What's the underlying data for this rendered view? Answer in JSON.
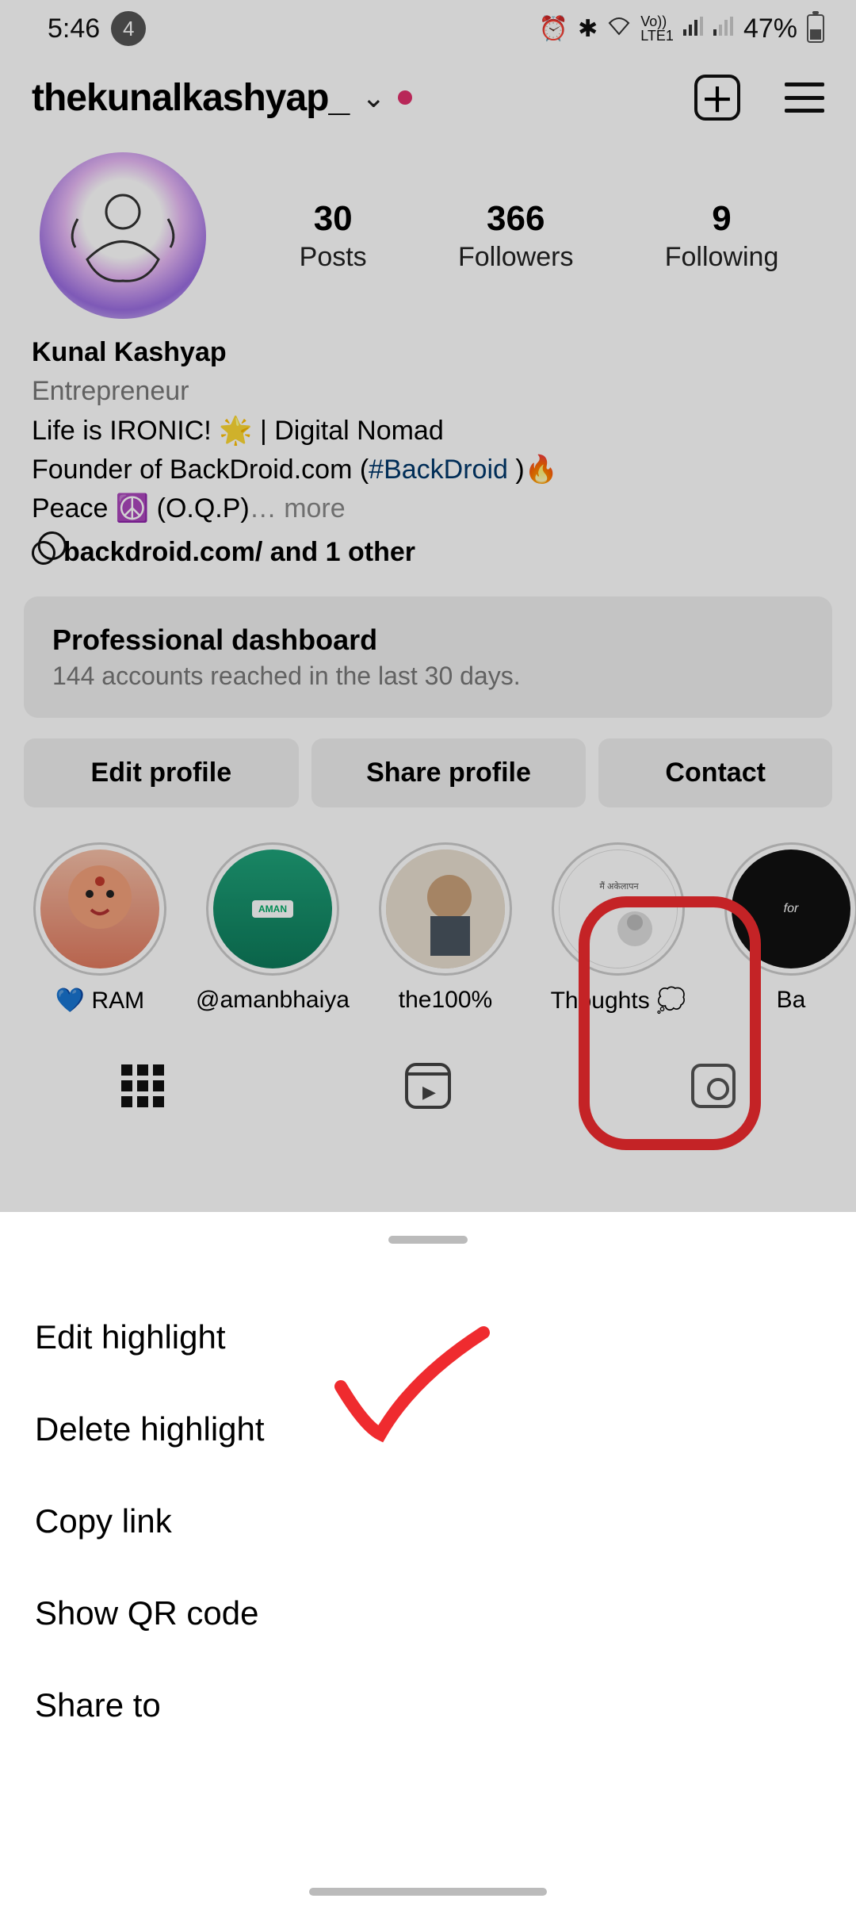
{
  "status": {
    "time": "5:46",
    "notif_count": "4",
    "battery": "47%"
  },
  "header": {
    "username": "thekunalkashyap_"
  },
  "stats": {
    "posts": {
      "num": "30",
      "label": "Posts"
    },
    "followers": {
      "num": "366",
      "label": "Followers"
    },
    "following": {
      "num": "9",
      "label": "Following"
    }
  },
  "bio": {
    "name": "Kunal Kashyap",
    "category": "Entrepreneur",
    "line1a": "Life is IRONIC! 🌟 | Digital Nomad",
    "line2a": "Founder of BackDroid.com (",
    "hashtag": "#BackDroid",
    "line2b": " )🔥",
    "line3a": "Peace ☮️ (O.Q.P)",
    "ellipsis": "… ",
    "more": "more",
    "link": "backdroid.com/ and 1 other"
  },
  "dashboard": {
    "title": "Professional dashboard",
    "sub": "144 accounts reached in the last 30 days."
  },
  "actions": {
    "edit": "Edit profile",
    "share": "Share profile",
    "contact": "Contact"
  },
  "highlights": [
    {
      "label": "💙 RAM"
    },
    {
      "label": "@amanbhaiya"
    },
    {
      "label": "the100%"
    },
    {
      "label": "Thoughts 💭"
    },
    {
      "label": "Ba"
    }
  ],
  "sheet": {
    "items": [
      "Edit highlight",
      "Delete highlight",
      "Copy link",
      "Show QR code",
      "Share to"
    ]
  }
}
